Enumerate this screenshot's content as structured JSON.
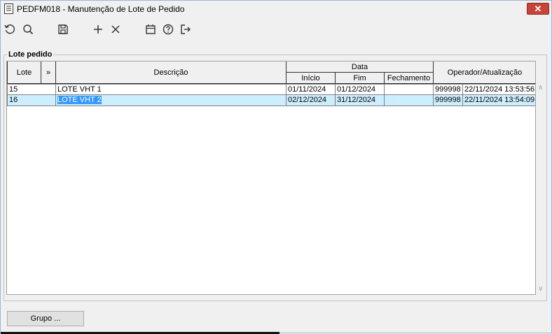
{
  "window": {
    "title": "PEDFM018 - Manutenção de Lote de Pedido",
    "close_label": "✕"
  },
  "toolbar": {
    "icons": [
      "refresh-icon",
      "search-icon",
      "save-icon",
      "add-icon",
      "delete-icon",
      "calendar-icon",
      "help-icon",
      "exit-icon"
    ]
  },
  "group": {
    "title": "Lote pedido"
  },
  "grid": {
    "headers": {
      "lote": "Lote",
      "expand": "»",
      "descricao": "Descrição",
      "data": "Data",
      "inicio": "Início",
      "fim": "Fim",
      "fechamento": "Fechamento",
      "operador": "Operador/Atualização"
    },
    "rows": [
      {
        "lote": "15",
        "descricao": "LOTE VHT 1",
        "inicio": "01/11/2024",
        "fim": "01/12/2024",
        "fechamento": "",
        "operador": "999998",
        "atualizacao": "22/11/2024 13:53:56"
      },
      {
        "lote": "16",
        "descricao": "LOTE VHT 2",
        "inicio": "02/12/2024",
        "fim": "31/12/2024",
        "fechamento": "",
        "operador": "999998",
        "atualizacao": "22/11/2024 13:54:09"
      }
    ],
    "selected_row_color": "#cdeefe"
  },
  "footer": {
    "grupo_button": "Grupo ..."
  }
}
